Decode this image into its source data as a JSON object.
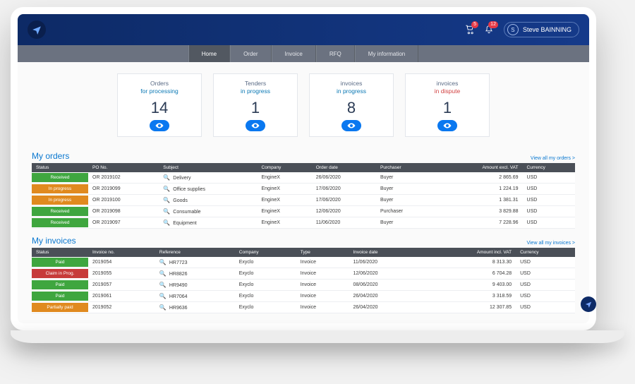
{
  "header": {
    "cart_badge": "5",
    "bell_badge": "12",
    "user_initial": "S",
    "user_name": "Steve BAINNING"
  },
  "nav": {
    "items": [
      "Home",
      "Order",
      "Invoice",
      "RFQ",
      "My information"
    ],
    "active": 0
  },
  "stats": [
    {
      "line1": "Orders",
      "line2": "for processing",
      "style": "line2",
      "value": "14"
    },
    {
      "line1": "Tenders",
      "line2": "in progress",
      "style": "line2",
      "value": "1"
    },
    {
      "line1": "invoices",
      "line2": "in progress",
      "style": "line2",
      "value": "8"
    },
    {
      "line1": "invoices",
      "line2": "in dispute",
      "style": "dispute",
      "value": "1"
    }
  ],
  "orders": {
    "title": "My orders",
    "view_all": "View all my orders >",
    "headers": [
      "Status",
      "PO No.",
      "Subject",
      "Company",
      "Order date",
      "Purchaser",
      "Amount excl. VAT",
      "Currency"
    ],
    "rows": [
      {
        "status": "Received",
        "statusClass": "st-green",
        "po": "OR 2019102",
        "subject": "Delivery",
        "company": "EngineX",
        "date": "26/06/2020",
        "purchaser": "Buyer",
        "amount": "2 865.69",
        "currency": "USD"
      },
      {
        "status": "In progress",
        "statusClass": "st-orange",
        "po": "OR 2019099",
        "subject": "Office supplies",
        "company": "EngineX",
        "date": "17/06/2020",
        "purchaser": "Buyer",
        "amount": "1 224.19",
        "currency": "USD"
      },
      {
        "status": "In progress",
        "statusClass": "st-orange",
        "po": "OR 2019100",
        "subject": "Goods",
        "company": "EngineX",
        "date": "17/06/2020",
        "purchaser": "Buyer",
        "amount": "1 381.31",
        "currency": "USD"
      },
      {
        "status": "Received",
        "statusClass": "st-green",
        "po": "OR 2019098",
        "subject": "Consumable",
        "company": "EngineX",
        "date": "12/06/2020",
        "purchaser": "Purchaser",
        "amount": "3 829.88",
        "currency": "USD"
      },
      {
        "status": "Received",
        "statusClass": "st-green",
        "po": "OR 2019097",
        "subject": "Equipment",
        "company": "EngineX",
        "date": "11/06/2020",
        "purchaser": "Buyer",
        "amount": "7 228.96",
        "currency": "USD"
      }
    ]
  },
  "invoices": {
    "title": "My invoices",
    "view_all": "View all my invoices >",
    "headers": [
      "Status",
      "Invoice no.",
      "Reference",
      "Company",
      "Type",
      "Invoice date",
      "Amount incl. VAT",
      "Currency"
    ],
    "rows": [
      {
        "status": "Paid",
        "statusClass": "st-green",
        "no": "2019054",
        "ref": "HR7723",
        "company": "Exyclo",
        "type": "Invoice",
        "date": "11/06/2020",
        "amount": "8 313.30",
        "currency": "USD"
      },
      {
        "status": "Claim in Prog.",
        "statusClass": "st-red",
        "no": "2019055",
        "ref": "HR8826",
        "company": "Exyclo",
        "type": "Invoice",
        "date": "12/06/2020",
        "amount": "6 704.28",
        "currency": "USD"
      },
      {
        "status": "Paid",
        "statusClass": "st-green",
        "no": "2019057",
        "ref": "HR9490",
        "company": "Exyclo",
        "type": "Invoice",
        "date": "08/06/2020",
        "amount": "9 403.00",
        "currency": "USD"
      },
      {
        "status": "Paid",
        "statusClass": "st-green",
        "no": "2019061",
        "ref": "HR7064",
        "company": "Exyclo",
        "type": "Invoice",
        "date": "26/04/2020",
        "amount": "3 318.59",
        "currency": "USD"
      },
      {
        "status": "Partially paid",
        "statusClass": "st-orange",
        "no": "2019052",
        "ref": "HR9636",
        "company": "Exyclo",
        "type": "Invoice",
        "date": "26/04/2020",
        "amount": "12 307.85",
        "currency": "USD"
      }
    ]
  }
}
